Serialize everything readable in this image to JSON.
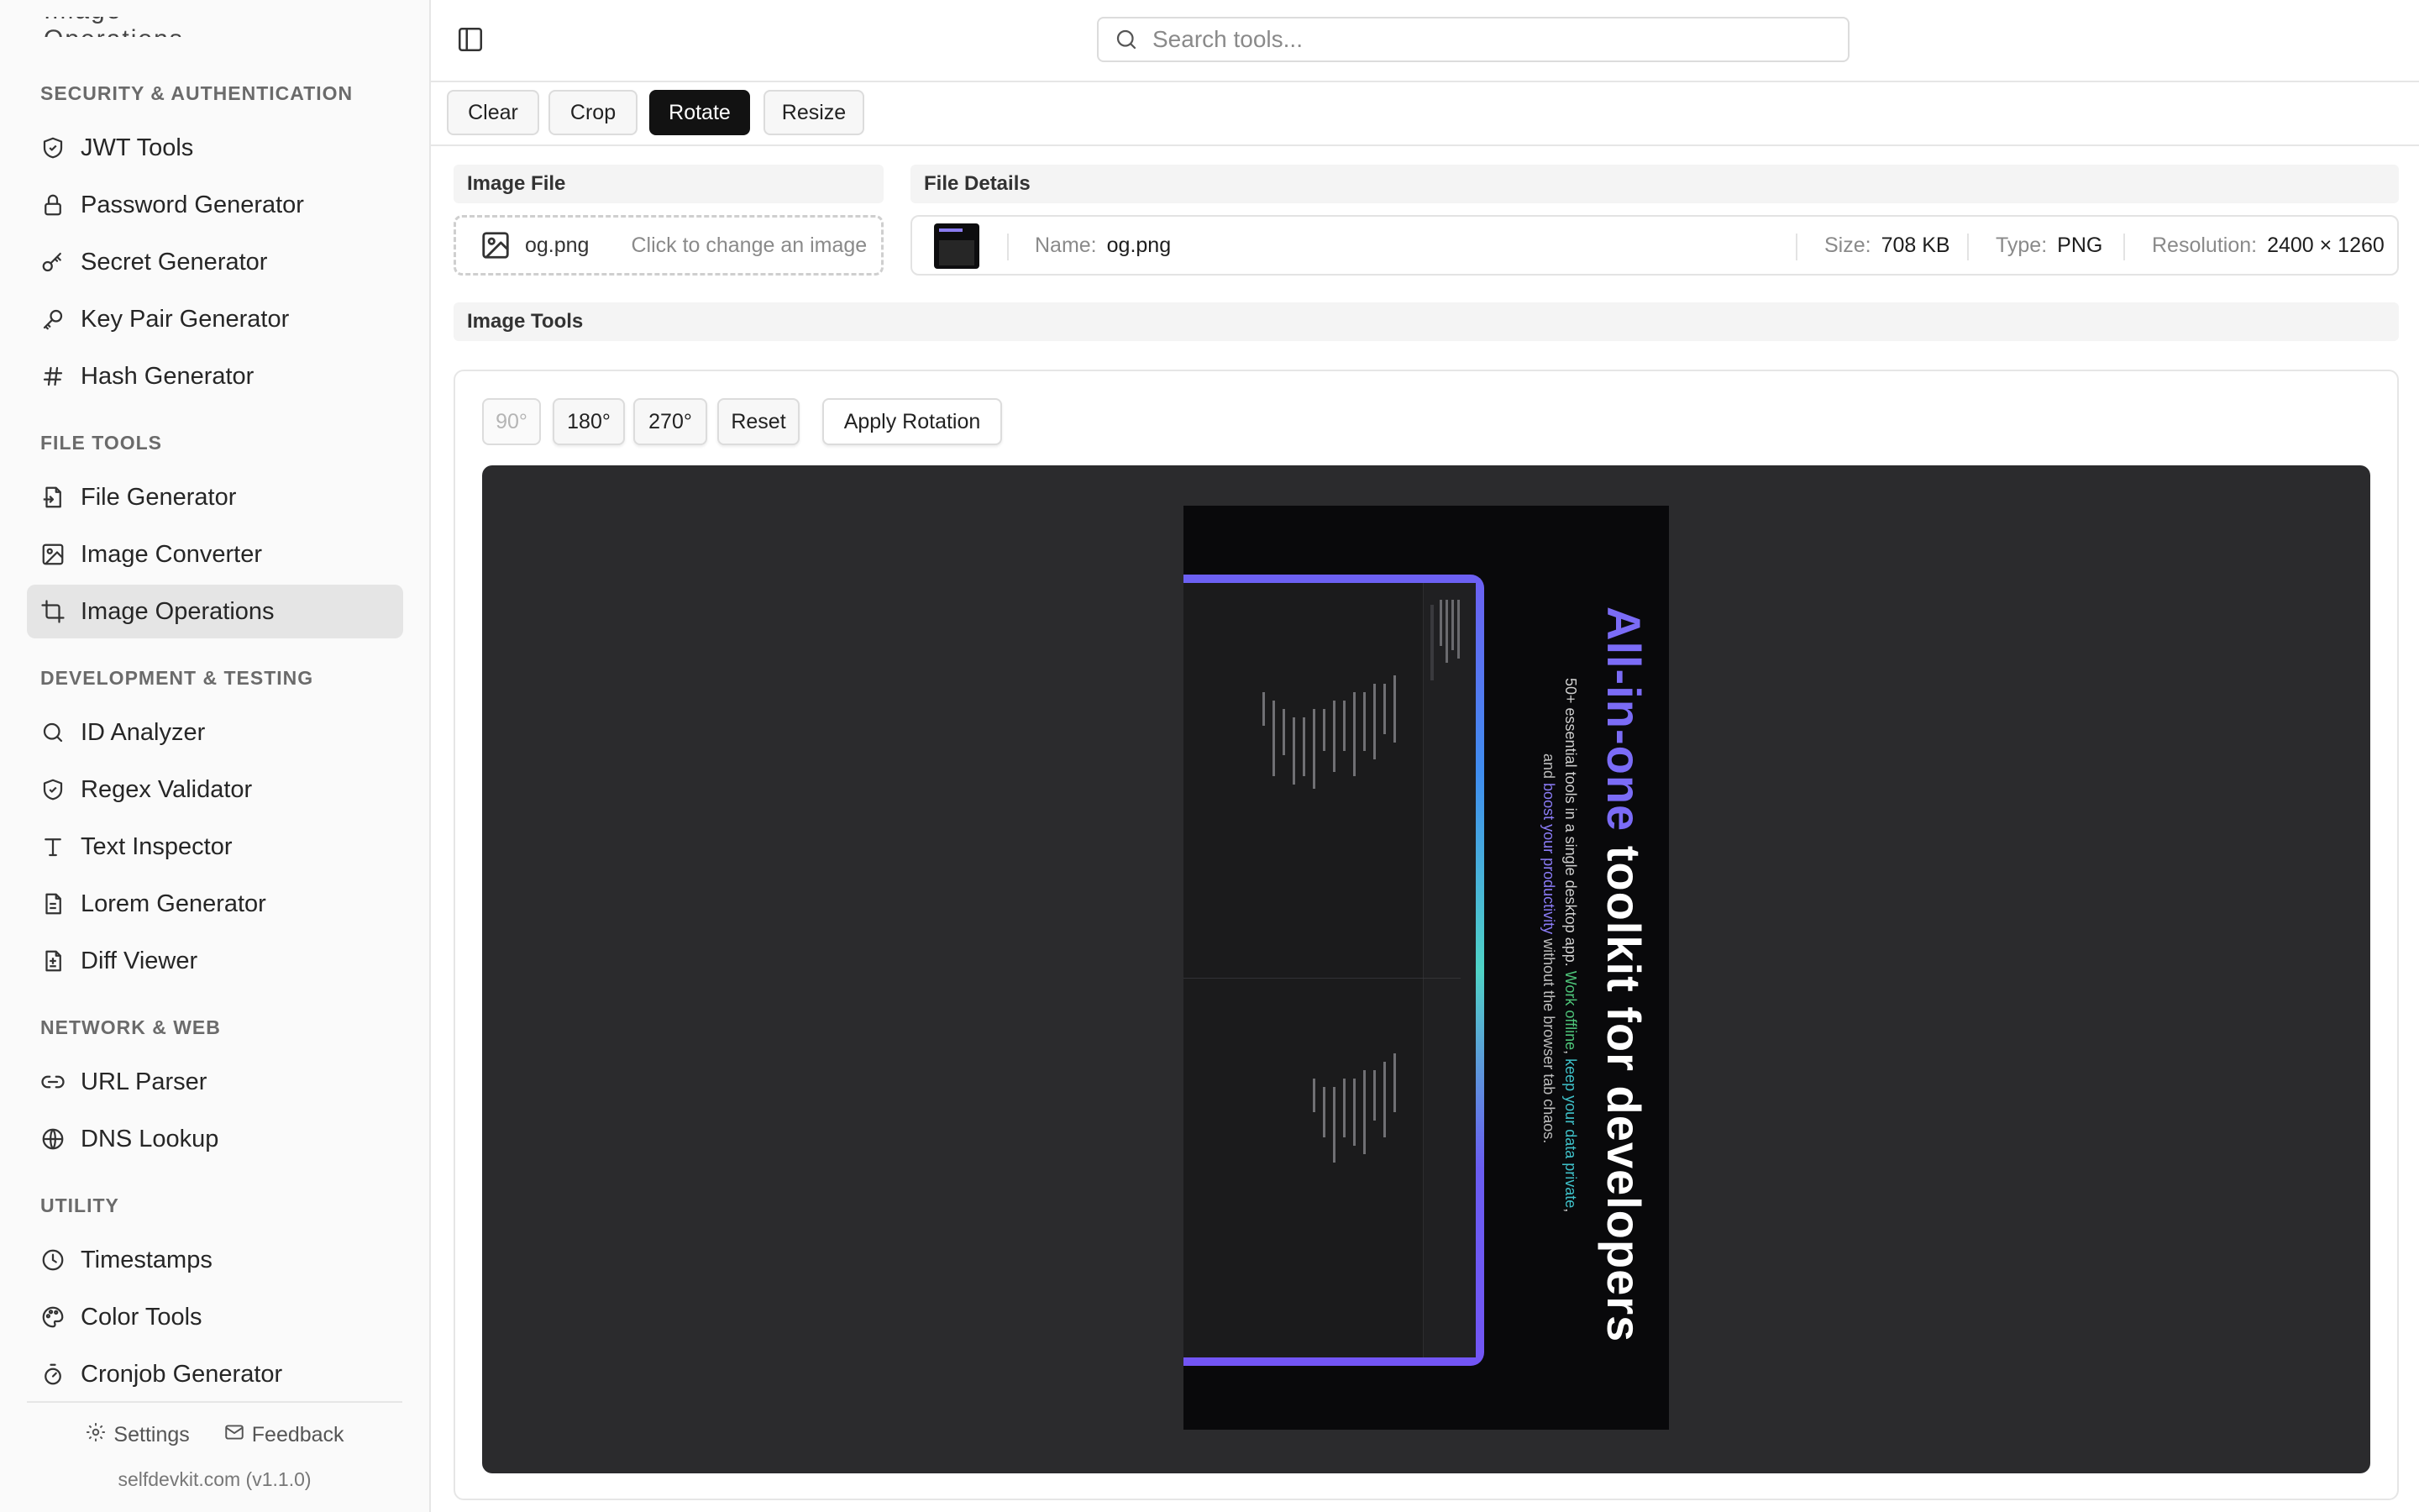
{
  "sidebar": {
    "cut_off_item": "Image Operations",
    "sections": [
      {
        "title": "SECURITY & AUTHENTICATION",
        "items": [
          {
            "label": "JWT Tools",
            "icon": "shield-icon"
          },
          {
            "label": "Password Generator",
            "icon": "lock-icon"
          },
          {
            "label": "Secret Generator",
            "icon": "key-round-icon"
          },
          {
            "label": "Key Pair Generator",
            "icon": "key-icon"
          },
          {
            "label": "Hash Generator",
            "icon": "hash-icon"
          }
        ]
      },
      {
        "title": "FILE TOOLS",
        "items": [
          {
            "label": "File Generator",
            "icon": "file-in-icon"
          },
          {
            "label": "Image Converter",
            "icon": "image-icon"
          },
          {
            "label": "Image Operations",
            "icon": "crop-icon",
            "active": true
          }
        ]
      },
      {
        "title": "DEVELOPMENT & TESTING",
        "items": [
          {
            "label": "ID Analyzer",
            "icon": "search-icon"
          },
          {
            "label": "Regex Validator",
            "icon": "shield-check-icon"
          },
          {
            "label": "Text Inspector",
            "icon": "type-icon"
          },
          {
            "label": "Lorem Generator",
            "icon": "file-text-icon"
          },
          {
            "label": "Diff Viewer",
            "icon": "file-diff-icon"
          }
        ]
      },
      {
        "title": "NETWORK & WEB",
        "items": [
          {
            "label": "URL Parser",
            "icon": "link-icon"
          },
          {
            "label": "DNS Lookup",
            "icon": "globe-icon"
          }
        ]
      },
      {
        "title": "UTILITY",
        "items": [
          {
            "label": "Timestamps",
            "icon": "clock-icon"
          },
          {
            "label": "Color Tools",
            "icon": "palette-icon"
          },
          {
            "label": "Cronjob Generator",
            "icon": "timer-icon"
          }
        ]
      }
    ],
    "footer": {
      "settings_label": "Settings",
      "feedback_label": "Feedback",
      "version": "selfdevkit.com (v1.1.0)"
    }
  },
  "topbar": {
    "search_placeholder": "Search tools..."
  },
  "toolbar": {
    "buttons": [
      {
        "label": "Clear"
      },
      {
        "label": "Crop"
      },
      {
        "label": "Rotate",
        "active": true
      },
      {
        "label": "Resize"
      }
    ]
  },
  "image_file": {
    "heading": "Image File",
    "file_name": "og.png",
    "hint": "Click to change an image"
  },
  "file_details": {
    "heading": "File Details",
    "name_label": "Name:",
    "name_value": "og.png",
    "size_label": "Size:",
    "size_value": "708 KB",
    "type_label": "Type:",
    "type_value": "PNG",
    "resolution_label": "Resolution:",
    "resolution_value": "2400 × 1260"
  },
  "image_tools": {
    "heading": "Image Tools",
    "rotate_buttons": [
      {
        "label": "90°",
        "disabled": true
      },
      {
        "label": "180°"
      },
      {
        "label": "270°"
      },
      {
        "label": "Reset"
      }
    ],
    "apply_label": "Apply Rotation"
  },
  "preview": {
    "title_accent": "All-in-one",
    "title_rest": " toolkit for developers",
    "line1_a": "50+ essential tools in a single desktop app. ",
    "line1_b": "Work offline",
    "line1_c": ", ",
    "line1_d": "keep your data private",
    "line1_e": ",",
    "line2_a": "and ",
    "line2_b": "boost your productivity",
    "line2_c": " without the browser tab chaos."
  },
  "colors": {
    "accent_dark": "#121212",
    "active_nav_bg": "#e5e5e5",
    "canvas_bg": "#2b2b2d",
    "brand_violet": "#7b6cf6"
  }
}
